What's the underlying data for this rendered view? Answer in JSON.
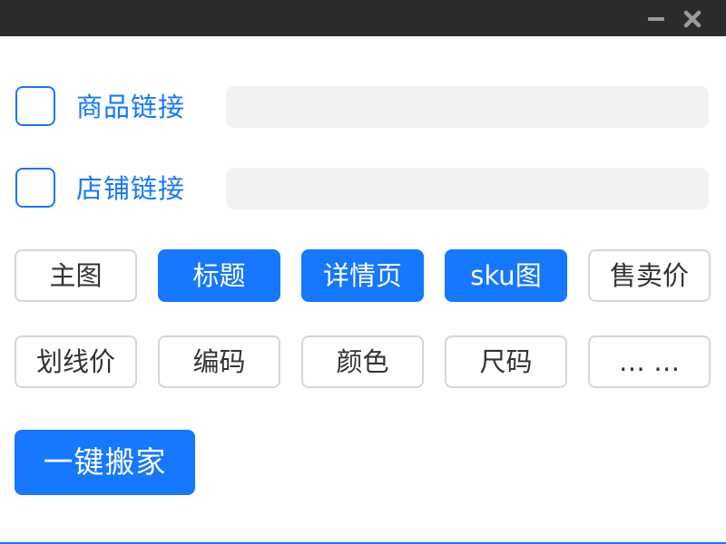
{
  "window": {
    "minimize_icon": "minimize-icon",
    "close_icon": "close-icon"
  },
  "links": [
    {
      "label": "商品链接",
      "value": "",
      "checked": false
    },
    {
      "label": "店铺链接",
      "value": "",
      "checked": false
    }
  ],
  "options": [
    {
      "label": "主图",
      "selected": false
    },
    {
      "label": "标题",
      "selected": true
    },
    {
      "label": "详情页",
      "selected": true
    },
    {
      "label": "sku图",
      "selected": true
    },
    {
      "label": "售卖价",
      "selected": false
    },
    {
      "label": "划线价",
      "selected": false
    },
    {
      "label": "编码",
      "selected": false
    },
    {
      "label": "颜色",
      "selected": false
    },
    {
      "label": "尺码",
      "selected": false
    },
    {
      "label": "… …",
      "selected": false
    }
  ],
  "action": {
    "label": "一键搬家"
  },
  "colors": {
    "accent": "#1677ff",
    "titlebar": "#2b2b2b",
    "input_bg": "#f2f2f2",
    "border": "#d6d6d6"
  }
}
